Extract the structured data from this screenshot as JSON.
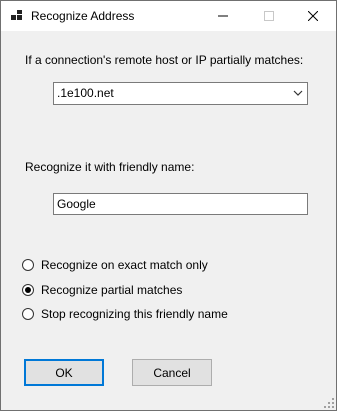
{
  "window": {
    "title": "Recognize Address"
  },
  "titlebar": {
    "icons": [
      "app-icon",
      "minimize-icon",
      "maximize-icon",
      "close-icon"
    ]
  },
  "form": {
    "host_label": "If a connection's remote host or IP partially matches:",
    "host_value": ".1e100.net",
    "name_label": "Recognize it with friendly name:",
    "name_value": "Google"
  },
  "options": [
    {
      "label": "Recognize on exact match only",
      "checked": false
    },
    {
      "label": "Recognize partial matches",
      "checked": true
    },
    {
      "label": "Stop recognizing this friendly name",
      "checked": false
    }
  ],
  "buttons": {
    "ok_label": "OK",
    "cancel_label": "Cancel"
  },
  "colors": {
    "accent": "#0078d7",
    "window_bg": "#f0f0f0",
    "titlebar_bg": "#ffffff"
  }
}
